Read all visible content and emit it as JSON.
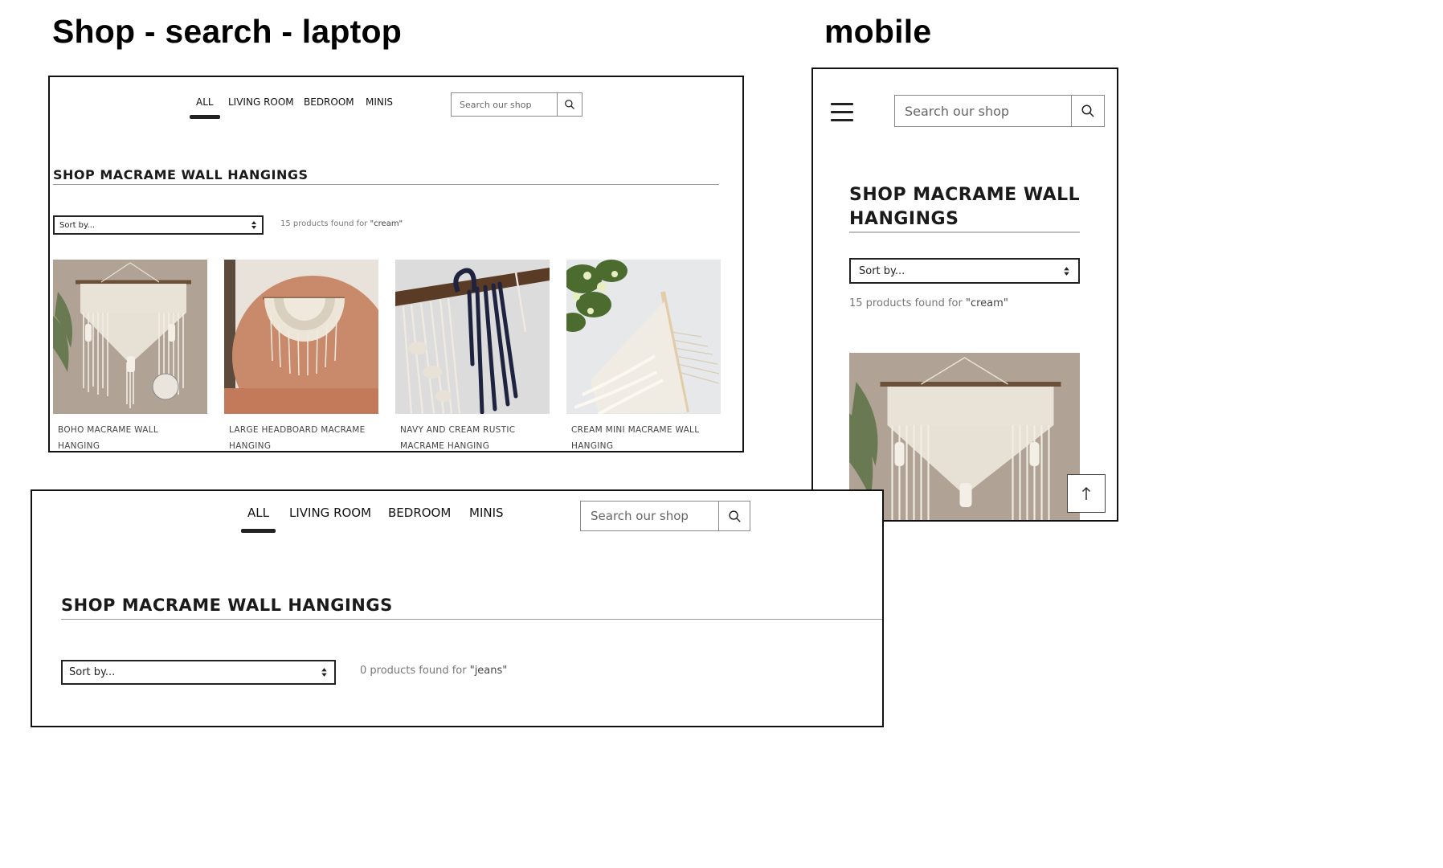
{
  "headings": {
    "laptop": "Shop - search - laptop",
    "mobile": "mobile"
  },
  "nav": {
    "items": [
      "ALL",
      "LIVING ROOM",
      "BEDROOM",
      "MINIS"
    ],
    "active": "ALL"
  },
  "search": {
    "placeholder": "Search our shop"
  },
  "shop_title": "SHOP MACRAME WALL HANGINGS",
  "mobile_title_lines": [
    "SHOP MACRAME WALL",
    "HANGINGS"
  ],
  "sort_label": "Sort by...",
  "results_cream": {
    "prefix": "15 products found for",
    "term": "\"cream\""
  },
  "results_jeans": {
    "prefix": "0 products found for",
    "term": "\"jeans\""
  },
  "products": [
    {
      "name_line1": "BOHO MACRAME WALL",
      "name_line2": "HANGING"
    },
    {
      "name_line1": "LARGE HEADBOARD MACRAME",
      "name_line2": "HANGING"
    },
    {
      "name_line1": "NAVY AND CREAM RUSTIC",
      "name_line2": "MACRAME HANGING"
    },
    {
      "name_line1": "CREAM MINI MACRAME WALL",
      "name_line2": "HANGING"
    }
  ],
  "colors": {
    "frame": "#111111",
    "accent": "#222222",
    "muted_text": "#777777",
    "background": "#ffffff"
  },
  "icons": [
    "search-icon",
    "chevron-updown-icon",
    "hamburger-icon",
    "arrow-up-icon"
  ]
}
